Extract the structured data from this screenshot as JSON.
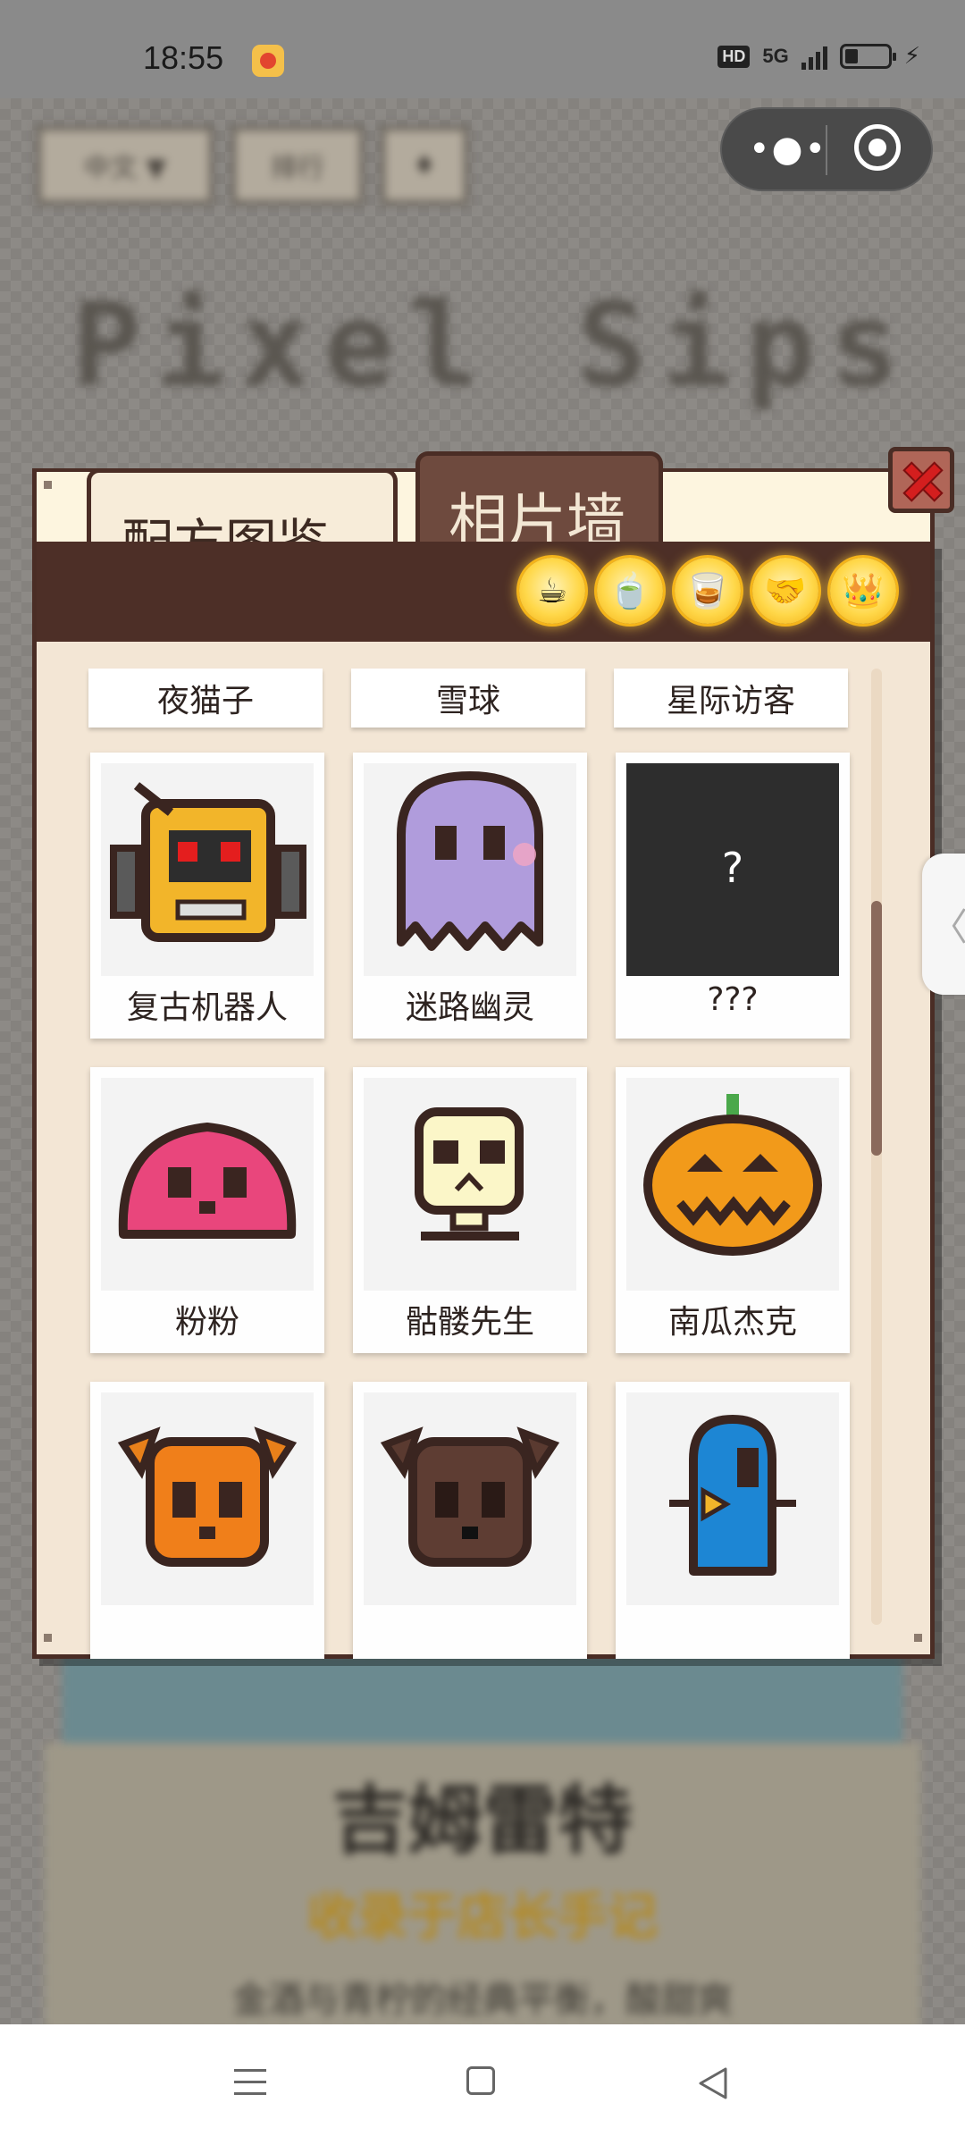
{
  "status_bar": {
    "time": "18:55",
    "app_icon": "weibo-icon",
    "hd_label": "HD",
    "network_label": "5G",
    "battery": "battery-low-icon",
    "charging": "charging-bolt-icon"
  },
  "background": {
    "buttons": [
      "中文 ▼",
      "排行",
      "♦"
    ],
    "title": "Pixel Sips",
    "headline": "吉姆雷特",
    "subline": "收录于店长手记",
    "description": "金酒与青柠的经典平衡，酸甜爽"
  },
  "mini_program_capsule": {
    "more_icon": "more-dots-icon",
    "close_icon": "target-circle-icon"
  },
  "modal": {
    "tabs": [
      {
        "label": "配方图鉴",
        "active": false
      },
      {
        "label": "相片墙",
        "active": true
      }
    ],
    "close_icon": "close-x-icon",
    "badges": [
      {
        "icon": "coffee-cup-icon",
        "glyph": "☕"
      },
      {
        "icon": "matcha-bowl-icon",
        "glyph": "🍵"
      },
      {
        "icon": "whiskey-glass-icon",
        "glyph": "🥃"
      },
      {
        "icon": "handshake-icon",
        "glyph": "🤝"
      },
      {
        "icon": "crown-icon",
        "glyph": "👑"
      }
    ],
    "partial_row": [
      "夜猫子",
      "雪球",
      "星际访客"
    ],
    "photos": [
      {
        "label": "复古机器人",
        "icon": "retro-robot-icon",
        "unlocked": true
      },
      {
        "label": "迷路幽灵",
        "icon": "lost-ghost-icon",
        "unlocked": true
      },
      {
        "label": "???",
        "icon": "locked-question-icon",
        "unlocked": false,
        "placeholder": "?"
      },
      {
        "label": "粉粉",
        "icon": "pink-slime-icon",
        "unlocked": true
      },
      {
        "label": "骷髅先生",
        "icon": "skeleton-icon",
        "unlocked": true
      },
      {
        "label": "南瓜杰克",
        "icon": "pumpkin-jack-icon",
        "unlocked": true
      },
      {
        "label": "",
        "icon": "orange-dog-icon",
        "unlocked": true
      },
      {
        "label": "",
        "icon": "brown-dog-icon",
        "unlocked": true
      },
      {
        "label": "",
        "icon": "blue-bird-robot-icon",
        "unlocked": true
      }
    ],
    "colors": {
      "frame": "#4a2d25",
      "panel_bg": "#f3e6d5",
      "active_tab": "#6e4a3e",
      "badge_gold": "#ffd84a"
    }
  },
  "side_tab_glyph": "〈",
  "nav_bar": {
    "menu_icon": "menu-lines-icon",
    "home_icon": "square-home-icon",
    "back_icon": "triangle-back-icon"
  }
}
